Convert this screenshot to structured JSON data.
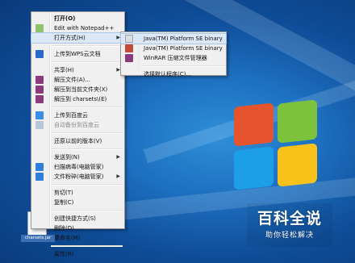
{
  "desktop_file": {
    "label": "charsets.jar"
  },
  "context_menu": {
    "open": "打开(O)",
    "edit_notepad": "Edit with Notepad++",
    "open_with": "打开方式(H)",
    "upload_wps": "上传到WPS云文档",
    "share": "共享(H)",
    "extract_files": "解压文件(A)...",
    "extract_here": "解压到当前文件夹(X)",
    "extract_to": "解压到 charsets\\(E)",
    "upload_baidu": "上传到百度云",
    "auto_backup": "自动备份到百度云",
    "restore": "还原以前的版本(V)",
    "send_to": "发送到(N)",
    "scan_virus": "扫描病毒(电脑管家)",
    "shred": "文件粉碎(电脑管家)",
    "cut": "剪切(T)",
    "copy": "复制(C)",
    "create_shortcut": "创建快捷方式(S)",
    "delete": "删除(D)",
    "rename": "重命名(M)",
    "properties": "属性(R)"
  },
  "open_with_menu": {
    "java1": "Java(TM) Platform SE binary",
    "java2": "Java(TM) Platform SE binary",
    "winrar": "WinRAR 压缩文件管理器",
    "choose": "选择默认程序(C)..."
  },
  "watermark": {
    "title": "百科全说",
    "subtitle": "助你轻松解决"
  },
  "colors": {
    "desktop": "#1d6fbf",
    "menu_bg": "#f0f0f0",
    "highlight": "#dde8f7"
  }
}
